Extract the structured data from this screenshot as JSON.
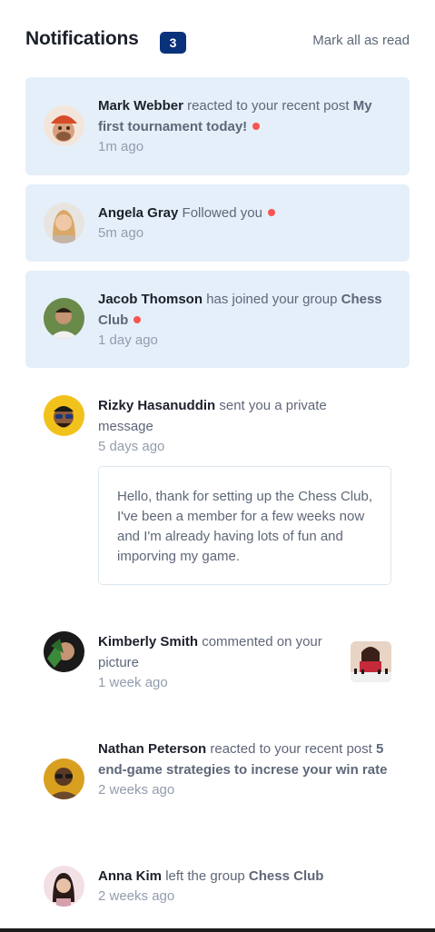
{
  "header": {
    "title": "Notifications",
    "unread_count": "3",
    "mark_all_label": "Mark all as read"
  },
  "notifications": [
    {
      "name": "Mark Webber",
      "action": "reacted to your recent post",
      "target": "My first tournament today!",
      "time": "1m ago",
      "unread": true,
      "avatar_icon": "avatar-mark-webber"
    },
    {
      "name": "Angela Gray",
      "action": "Followed you",
      "target": "",
      "time": "5m ago",
      "unread": true,
      "avatar_icon": "avatar-angela-gray"
    },
    {
      "name": "Jacob Thomson",
      "action": "has joined your group",
      "target": "Chess Club",
      "time": "1 day ago",
      "unread": true,
      "avatar_icon": "avatar-jacob-thomson"
    },
    {
      "name": "Rizky Hasanuddin",
      "action": "sent you a private message",
      "target": "",
      "time": "5 days ago",
      "unread": false,
      "avatar_icon": "avatar-rizky-hasanuddin",
      "message": "Hello, thank for setting up the Chess Club, I've been a member for a few weeks now and I'm already having lots of fun and imporving my game."
    },
    {
      "name": "Kimberly Smith",
      "action": "commented on your picture",
      "target": "",
      "time": "1 week ago",
      "unread": false,
      "avatar_icon": "avatar-kimberly-smith",
      "picture_icon": "chess-picture-thumbnail"
    },
    {
      "name": "Nathan Peterson",
      "action": "reacted to your recent post",
      "target": "5 end-game strategies to increse your win rate",
      "time": "2 weeks ago",
      "unread": false,
      "avatar_icon": "avatar-nathan-peterson"
    },
    {
      "name": "Anna Kim",
      "action": "left the group",
      "target": "Chess Club",
      "time": "2 weeks ago",
      "unread": false,
      "avatar_icon": "avatar-anna-kim"
    }
  ],
  "colors": {
    "unread_bg": "#e5effa",
    "badge_bg": "#0a327b",
    "dot": "#f65552",
    "heading": "#1c202b",
    "text": "#5e6778",
    "muted": "#939cad"
  }
}
